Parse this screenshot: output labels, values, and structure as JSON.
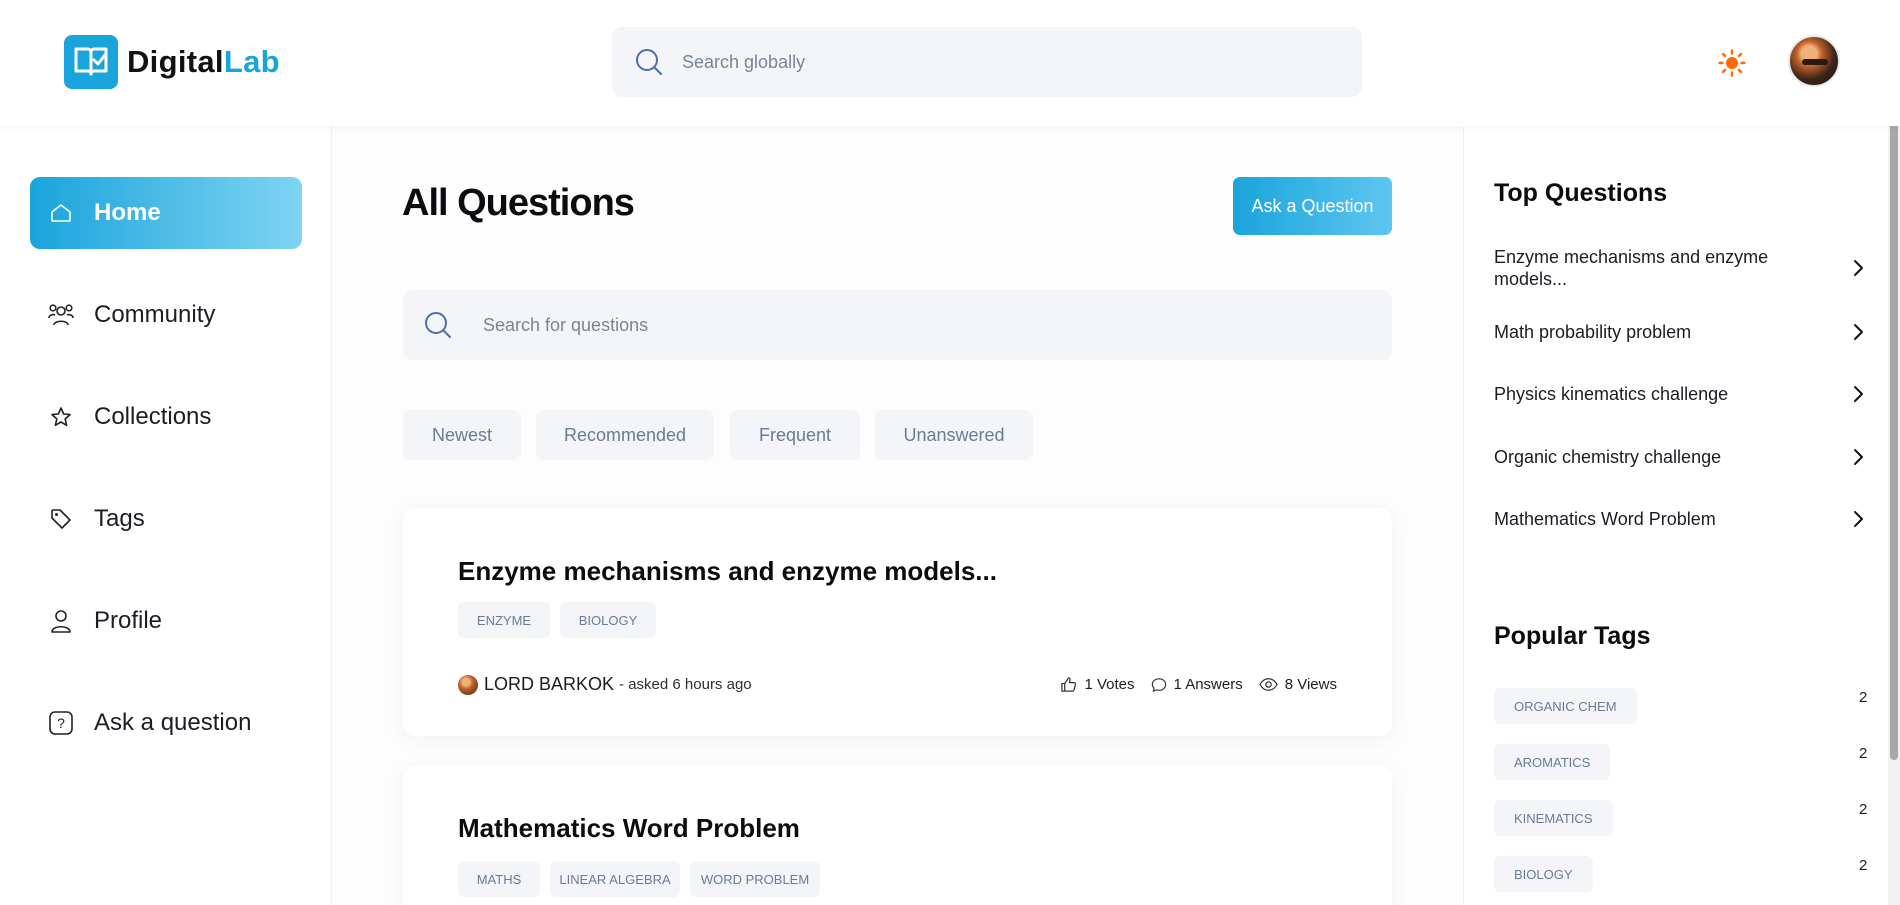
{
  "header": {
    "logo": {
      "part1": "Digital",
      "part2": "Lab",
      "accent": "#1aa4dc"
    },
    "global_search": {
      "placeholder": "Search globally"
    },
    "theme_icon": "sun-icon",
    "theme_color": "#ff6a00"
  },
  "sidebar": {
    "items": [
      {
        "label": "Home",
        "icon": "home-icon",
        "active": true
      },
      {
        "label": "Community",
        "icon": "users-icon"
      },
      {
        "label": "Collections",
        "icon": "star-icon"
      },
      {
        "label": "Tags",
        "icon": "tag-icon"
      },
      {
        "label": "Profile",
        "icon": "user-icon"
      },
      {
        "label": "Ask a question",
        "icon": "question-icon"
      }
    ]
  },
  "main": {
    "title": "All Questions",
    "ask_button": "Ask a Question",
    "search": {
      "placeholder": "Search for questions"
    },
    "filters": [
      "Newest",
      "Recommended",
      "Frequent",
      "Unanswered"
    ],
    "questions": [
      {
        "title": "Enzyme mechanisms and enzyme models...",
        "tags": [
          "ENZYME",
          "BIOLOGY"
        ],
        "author": "LORD BARKOK",
        "asked": "- asked 6 hours ago",
        "votes": "1 Votes",
        "answers": "1 Answers",
        "views": "8 Views"
      },
      {
        "title": "Mathematics Word Problem",
        "tags": [
          "MATHS",
          "LINEAR ALGEBRA",
          "WORD PROBLEM"
        ]
      }
    ]
  },
  "rightbar": {
    "top_questions_heading": "Top Questions",
    "top_questions": [
      "Enzyme mechanisms and enzyme models...",
      "Math probability problem",
      "Physics kinematics challenge",
      "Organic chemistry challenge",
      "Mathematics Word Problem"
    ],
    "popular_tags_heading": "Popular Tags",
    "popular_tags": [
      {
        "name": "ORGANIC CHEM",
        "count": "2"
      },
      {
        "name": "AROMATICS",
        "count": "2"
      },
      {
        "name": "KINEMATICS",
        "count": "2"
      },
      {
        "name": "BIOLOGY",
        "count": "2"
      }
    ]
  }
}
